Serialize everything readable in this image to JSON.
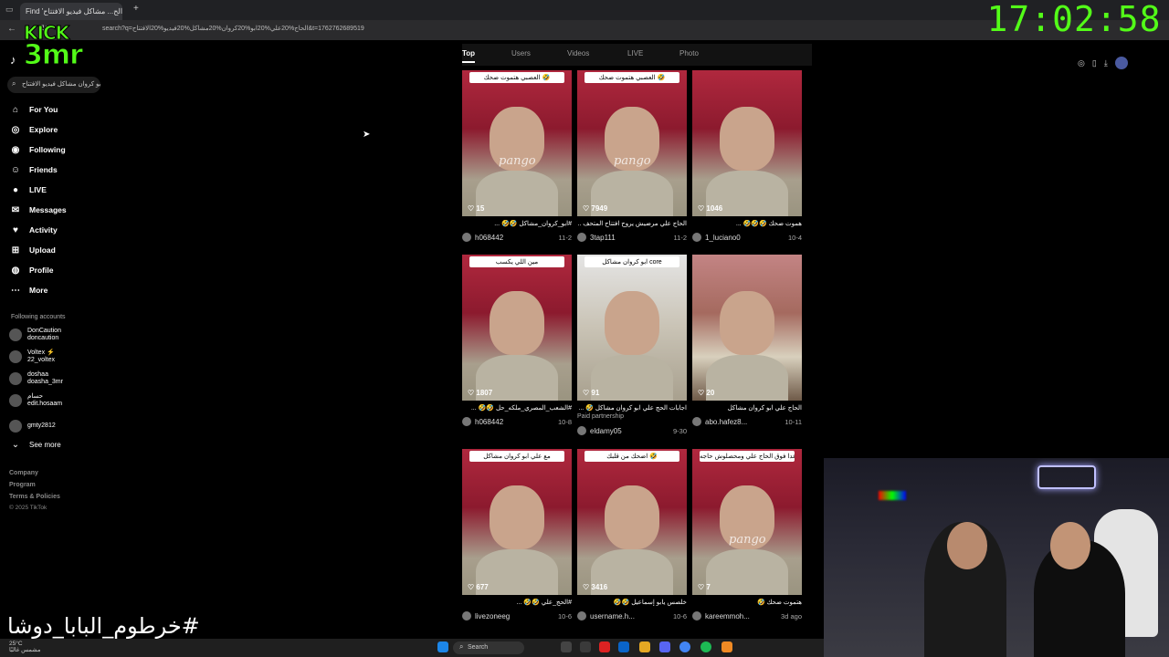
{
  "browser": {
    "tab_title": "Find 'الحاج علي ابو كروان مشاكل فيديو الافتتاح' on TikTok",
    "tab_short": "Find 'الح... مشاكل فيديو الافتتاح'",
    "url": "search?q=الحاج%20علي%20ابو%20كروان%20مشاكل%20فيديو%20الافتتاح&t=1762762689519"
  },
  "overlay": {
    "logo_line1": "KICK",
    "logo_line2": "3mr",
    "clock": "17:02:58",
    "hashtag": "#خرطوم_البابا_دوشا"
  },
  "sidebar": {
    "search_value": "ابو كروان مشاكل فيديو الافتتاح",
    "nav": [
      {
        "label": "For You",
        "icon": "home-icon"
      },
      {
        "label": "Explore",
        "icon": "compass-icon"
      },
      {
        "label": "Following",
        "icon": "following-icon"
      },
      {
        "label": "Friends",
        "icon": "friends-icon"
      },
      {
        "label": "LIVE",
        "icon": "live-icon"
      },
      {
        "label": "Messages",
        "icon": "messages-icon"
      },
      {
        "label": "Activity",
        "icon": "activity-icon"
      },
      {
        "label": "Upload",
        "icon": "upload-icon"
      },
      {
        "label": "Profile",
        "icon": "profile-icon"
      },
      {
        "label": "More",
        "icon": "more-icon"
      }
    ],
    "following_title": "Following accounts",
    "accounts": [
      {
        "name": "DonCaution",
        "handle": "doncaution"
      },
      {
        "name": "Voltex ⚡",
        "handle": "22_voltex"
      },
      {
        "name": "doshaa",
        "handle": "doasha_3mr"
      },
      {
        "name": "حسام",
        "handle": "edit.hosaam"
      },
      {
        "name": "",
        "handle": "gmty2812"
      }
    ],
    "see_more": "See more",
    "footer": [
      "Company",
      "Program",
      "Terms & Policies",
      "© 2025 TikTok"
    ]
  },
  "search_tabs": [
    "Top",
    "Users",
    "Videos",
    "LIVE",
    "Photo"
  ],
  "cards": [
    {
      "caption": "العصبي هتموت ضحك 🤣",
      "views": "15",
      "desc": "#ابو_كروان_مشاكل 🤣🤣 ...",
      "user": "h068442",
      "date": "11-2",
      "paid": ""
    },
    {
      "caption": "العصبي هتموت ضحك 🤣",
      "views": "7949",
      "desc": "الحاج علي مرضيش يروح افتتاح المتحف ...",
      "user": "3tap111",
      "date": "11-2",
      "paid": ""
    },
    {
      "caption": "",
      "views": "1046",
      "desc": "هموت ضحك 🤣🤣🤣 ...",
      "user": "1_luciano0",
      "date": "10-4",
      "paid": ""
    },
    {
      "caption": "مين اللي يكسب",
      "views": "1807",
      "desc": "#الشعب_المصري_ملكه_حل 🤣🤣 ...",
      "user": "h068442",
      "date": "10-8",
      "paid": ""
    },
    {
      "caption": "ابو كروان مشاكل core",
      "views": "91",
      "desc": "اجابات الحج علي ابو كروان مشاكل 🤣 ...",
      "user": "eldamy05",
      "date": "9-30",
      "paid": "Paid partnership"
    },
    {
      "caption": "",
      "views": "20",
      "desc": "الحاج علي ابو كروان مشاكل",
      "user": "abo.hafez8...",
      "date": "10-11",
      "paid": ""
    },
    {
      "caption": "مع علي ابو كروان مشاكل",
      "views": "677",
      "desc": "#الحج_علي 🤣🤣 ...",
      "user": "livezoneeg",
      "date": "10-6",
      "paid": ""
    },
    {
      "caption": "اضحك من قلبك 🤣",
      "views": "3416",
      "desc": "خلصس يابو إسماعيل 🤣🤣",
      "user": "username.h...",
      "date": "10-6",
      "paid": ""
    },
    {
      "caption": "الفطر عدا فوق الحاج علي ومحصلوش حاجه 🤣",
      "views": "7",
      "desc": "هتموت ضحك 🤣",
      "user": "kareemmoh...",
      "date": "3d ago",
      "paid": ""
    }
  ],
  "watermark": "pango",
  "taskbar": {
    "search_label": "Search",
    "weather_temp": "25°C",
    "weather_desc": "مشمس غالبًا"
  }
}
